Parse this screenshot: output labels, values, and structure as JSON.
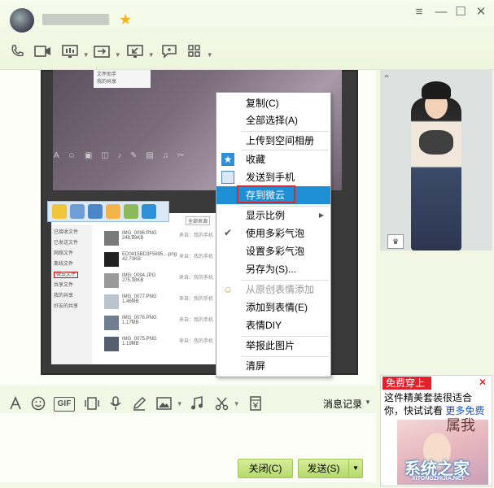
{
  "header": {
    "username": "",
    "vip_icon": "★"
  },
  "window": {
    "menu_icon": "≡",
    "minimize": "—",
    "maximize": "☐",
    "close": "✕"
  },
  "toolbar": {
    "icons": [
      "phone-icon",
      "video-icon",
      "screen-share-icon",
      "file-transfer-icon",
      "remote-desktop-icon",
      "message-icon",
      "apps-icon"
    ]
  },
  "screenshot_content": {
    "popup_lines": [
      "文件助手",
      "我的共享"
    ],
    "sidebar": [
      "已接收文件",
      "已发送文件",
      "网络文件",
      "离线文件",
      "微云文件",
      "共享文件",
      "我的共享",
      "好友的共享"
    ],
    "rows": [
      {
        "name": "IMG_0096.PNG",
        "size": "248.89KB",
        "device": "来自：我的手机"
      },
      {
        "name": "ED0415BD3F5895....png",
        "size": "42.73KB",
        "device": "来自：我的手机"
      },
      {
        "name": "IMG_0094.JPG",
        "size": "275.38KB",
        "device": "来自：我的手机"
      },
      {
        "name": "IMG_0077.PNG",
        "size": "1.46MB",
        "device": "来自：我的手机"
      },
      {
        "name": "IMG_0076.PNG",
        "size": "1.17MB",
        "device": "来自：我的手机"
      },
      {
        "name": "IMG_0075.PNG",
        "size": "1.19MB",
        "device": "来自：我的手机"
      }
    ],
    "filter_label": "全部来源"
  },
  "context_menu": {
    "items": [
      {
        "label": "复制(C)",
        "state": "normal"
      },
      {
        "label": "全部选择(A)",
        "state": "normal"
      },
      {
        "label": "上传到空间相册",
        "state": "normal"
      },
      {
        "label": "收藏",
        "state": "normal"
      },
      {
        "label": "发送到手机",
        "state": "normal"
      },
      {
        "label": "存到微云",
        "state": "selected"
      },
      {
        "label": "显示比例",
        "state": "submenu"
      },
      {
        "label": "使用多彩气泡",
        "state": "checked"
      },
      {
        "label": "设置多彩气泡",
        "state": "normal"
      },
      {
        "label": "另存为(S)...",
        "state": "normal"
      },
      {
        "label": "从原创表情添加",
        "state": "disabled"
      },
      {
        "label": "添加到表情(E)",
        "state": "normal"
      },
      {
        "label": "表情DIY",
        "state": "normal"
      },
      {
        "label": "举报此图片",
        "state": "normal"
      },
      {
        "label": "清屏",
        "state": "normal"
      }
    ],
    "submenu_arrow": "▶",
    "check_mark": "✔"
  },
  "input_toolbar": {
    "icons": [
      "font-icon",
      "emoji-icon",
      "gif-icon",
      "shake-icon",
      "voice-icon",
      "doodle-icon",
      "image-icon",
      "music-icon",
      "screenshot-icon",
      "red-packet-icon"
    ],
    "gif_label": "GIF",
    "history_label": "消息记录"
  },
  "buttons": {
    "close_label": "关闭(C)",
    "send_label": "发送(S)"
  },
  "ad": {
    "tag": "免费穿上",
    "text": "这件精美套装很适合你，快试试看",
    "link": "更多免费",
    "calligraphy": "属我"
  },
  "watermark": {
    "text": "系统之家",
    "url": "XITONGZHIJIA.NET"
  },
  "colors": {
    "accent_selected": "#1e8fd5",
    "highlight_box": "#e0252b",
    "button_green": "#b5d96a",
    "ad_red": "#e1222c"
  }
}
